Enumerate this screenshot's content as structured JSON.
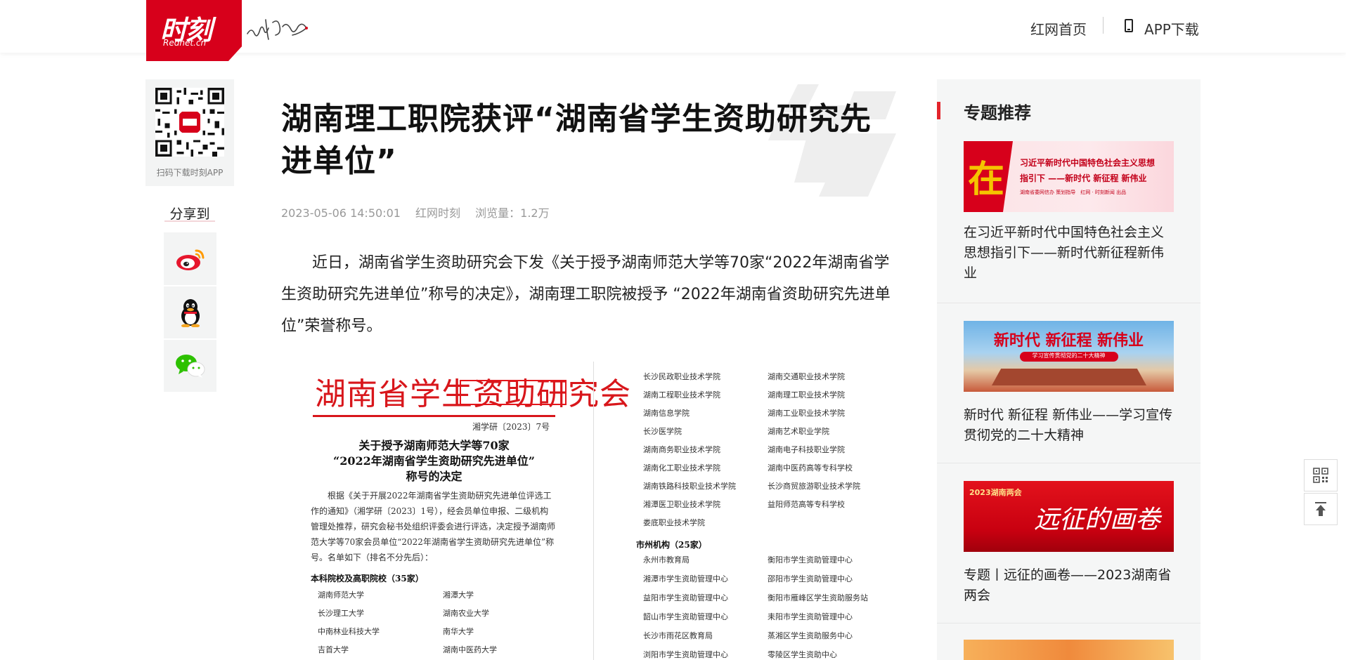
{
  "header": {
    "logo_text": "时刻",
    "logo_sub": "Rednet.cn",
    "nav_home": "红网首页",
    "nav_app": "APP下载"
  },
  "left": {
    "qr_label": "扫码下载时刻APP",
    "share_title": "分享到"
  },
  "article": {
    "title": "湖南理工职院获评“湖南省学生资助研究先进单位”",
    "date": "2023-05-06 14:50:01",
    "source": "红网时刻",
    "views": "浏览量：1.2万",
    "body": "近日，湖南省学生资助研究会下发《关于授予湖南师范大学等70家“2022年湖南省学生资助研究先进单位”称号的决定》，湖南理工职院被授予 “2022年湖南省资助研究先进单位”荣誉称号。"
  },
  "document": {
    "org": "湖南省学生资助研究会",
    "doc_number": "湘学研〔2023〕7号",
    "heading_1": "关于授予湖南师范大学等70家",
    "heading_2": "“2022年湖南省学生资助研究先进单位”",
    "heading_3": "称号的决定",
    "paragraph": "根据《关于开展2022年湖南省学生资助研究先进单位评选工作的通知》（湘学研〔2023〕1号），经会员单位申报、二级机构管理处推荐，研究会秘书处组织评委会进行评选，决定授予湖南师范大学等70家会员单位“2022年湖南省学生资助研究先进单位”称号。名单如下（排名不分先后）：",
    "section_1": "本科院校及高职院校（35家）",
    "section_2": "市州机构（25家）",
    "left_list": [
      [
        "湖南师范大学",
        "湘潭大学"
      ],
      [
        "长沙理工大学",
        "湖南农业大学"
      ],
      [
        "中南林业科技大学",
        "南华大学"
      ],
      [
        "吉首大学",
        "湖南中医药大学"
      ]
    ],
    "right_list": [
      [
        "长沙民政职业技术学院",
        "湖南交通职业技术学院"
      ],
      [
        "湖南工程职业技术学院",
        "湖南理工职业技术学院"
      ],
      [
        "湖南信息学院",
        "湖南工业职业技术学院"
      ],
      [
        "长沙医学院",
        "湖南艺术职业学院"
      ],
      [
        "湖南商务职业技术学院",
        "湖南电子科技职业学院"
      ],
      [
        "湖南化工职业技术学院",
        "湖南中医药高等专科学校"
      ],
      [
        "湖南铁路科技职业技术学院",
        "长沙商贸旅游职业技术学院"
      ],
      [
        "湘潭医卫职业技术学院",
        "益阳师范高等专科学校"
      ],
      [
        "娄底职业技术学院",
        ""
      ]
    ],
    "city_list": [
      [
        "永州市教育局",
        "衡阳市学生资助管理中心"
      ],
      [
        "湘潭市学生资助管理中心",
        "邵阳市学生资助管理中心"
      ],
      [
        "益阳市学生资助管理中心",
        "衡阳市雁峰区学生资助服务站"
      ],
      [
        "韶山市学生资助管理中心",
        "耒阳市学生资助管理中心"
      ],
      [
        "长沙市雨花区教育局",
        "蒸湘区学生资助服务中心"
      ],
      [
        "浏阳市学生资助管理中心",
        "零陵区学生资助中心"
      ]
    ]
  },
  "sidebar": {
    "title": "专题推荐",
    "items": [
      {
        "text": "在习近平新时代中国特色社会主义思想指引下——新时代新征程新伟业",
        "banner_big": "在",
        "banner_line1": "习近平新时代中国特色社会主义思想",
        "banner_line2": "指引下 ——新时代 新征程 新伟业",
        "banner_line3": "湖南省委网信办 策划指导　红网 · 时刻新闻 出品"
      },
      {
        "text": "新时代 新征程 新伟业——学习宣传贯彻党的二十大精神",
        "banner_line1": "新时代 新征程 新伟业",
        "banner_line2": "学习宣传贯彻党的二十大精神"
      },
      {
        "text": "专题丨远征的画卷——2023湖南省两会",
        "banner_line1": "2023湖南两会",
        "banner_line2": "远征的画卷"
      }
    ]
  },
  "colors": {
    "brand_red": "#d7001b",
    "sidebar_bg": "#f5f6f6",
    "accent_bar": "#e3242b"
  }
}
